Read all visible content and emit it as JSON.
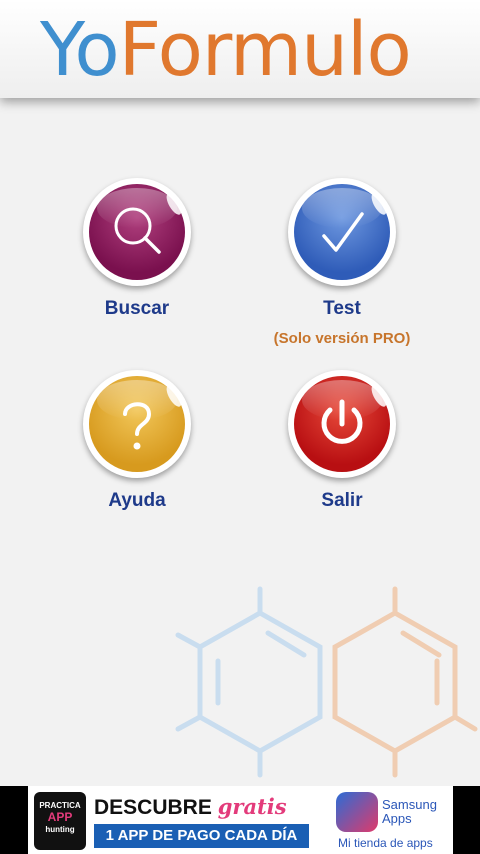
{
  "header": {
    "logo_part1": "Yo",
    "logo_part2": "Formulo"
  },
  "menu": {
    "search": {
      "label": "Buscar",
      "icon": "magnifier-icon",
      "color": "#8a1b5c"
    },
    "test": {
      "label": "Test",
      "note": "(Solo versión PRO)",
      "icon": "checkmark-icon",
      "color": "#3c6cc8"
    },
    "help": {
      "label": "Ayuda",
      "icon": "question-icon",
      "color": "#e0a52a"
    },
    "exit": {
      "label": "Salir",
      "icon": "power-icon",
      "color": "#cc1a1a"
    }
  },
  "ad": {
    "badge_line1": "PRACTICA",
    "badge_line2": "APP",
    "badge_line3": "hunting",
    "title_part1": "DESCUBRE",
    "title_part2": "gratis",
    "subtitle": "1 APP DE PAGO CADA DÍA",
    "store_name": "Samsung Apps",
    "store_tagline": "Mi tienda de apps"
  },
  "colors": {
    "label": "#1e3a8a",
    "note": "#c7752c",
    "brand_blue": "#3f8fcf",
    "brand_orange": "#e0782e"
  }
}
